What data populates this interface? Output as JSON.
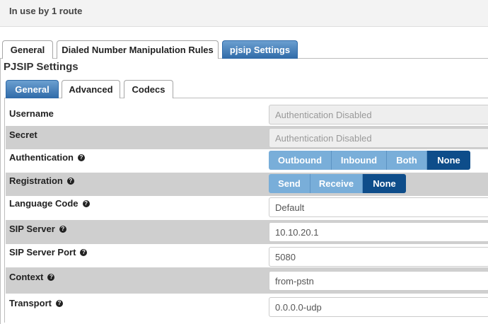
{
  "banner": {
    "text": "In use by 1 route"
  },
  "outer_tabs": [
    {
      "label": "General",
      "active": false
    },
    {
      "label": "Dialed Number Manipulation Rules",
      "active": false
    },
    {
      "label": "pjsip Settings",
      "active": true
    }
  ],
  "section_title": "PJSIP Settings",
  "inner_tabs": [
    {
      "label": "General",
      "active": true
    },
    {
      "label": "Advanced",
      "active": false
    },
    {
      "label": "Codecs",
      "active": false
    }
  ],
  "form": {
    "username": {
      "label": "Username",
      "value": "Authentication Disabled"
    },
    "secret": {
      "label": "Secret",
      "value": "Authentication Disabled"
    },
    "authentication": {
      "label": "Authentication",
      "options": [
        "Outbound",
        "Inbound",
        "Both",
        "None"
      ],
      "selected": "None"
    },
    "registration": {
      "label": "Registration",
      "options": [
        "Send",
        "Receive",
        "None"
      ],
      "selected": "None"
    },
    "language_code": {
      "label": "Language Code",
      "value": "Default"
    },
    "sip_server": {
      "label": "SIP Server",
      "value": "10.10.20.1"
    },
    "sip_server_port": {
      "label": "SIP Server Port",
      "value": "5080"
    },
    "context": {
      "label": "Context",
      "value": "from-pstn"
    },
    "transport": {
      "label": "Transport",
      "value": "0.0.0.0-udp"
    }
  },
  "colors": {
    "tab_active": "#2f6aa8",
    "segment": "#79aed9",
    "segment_active": "#0e4d8a",
    "row_gray": "#cfcfcf"
  },
  "icons": {
    "help": "question-circle-icon"
  }
}
